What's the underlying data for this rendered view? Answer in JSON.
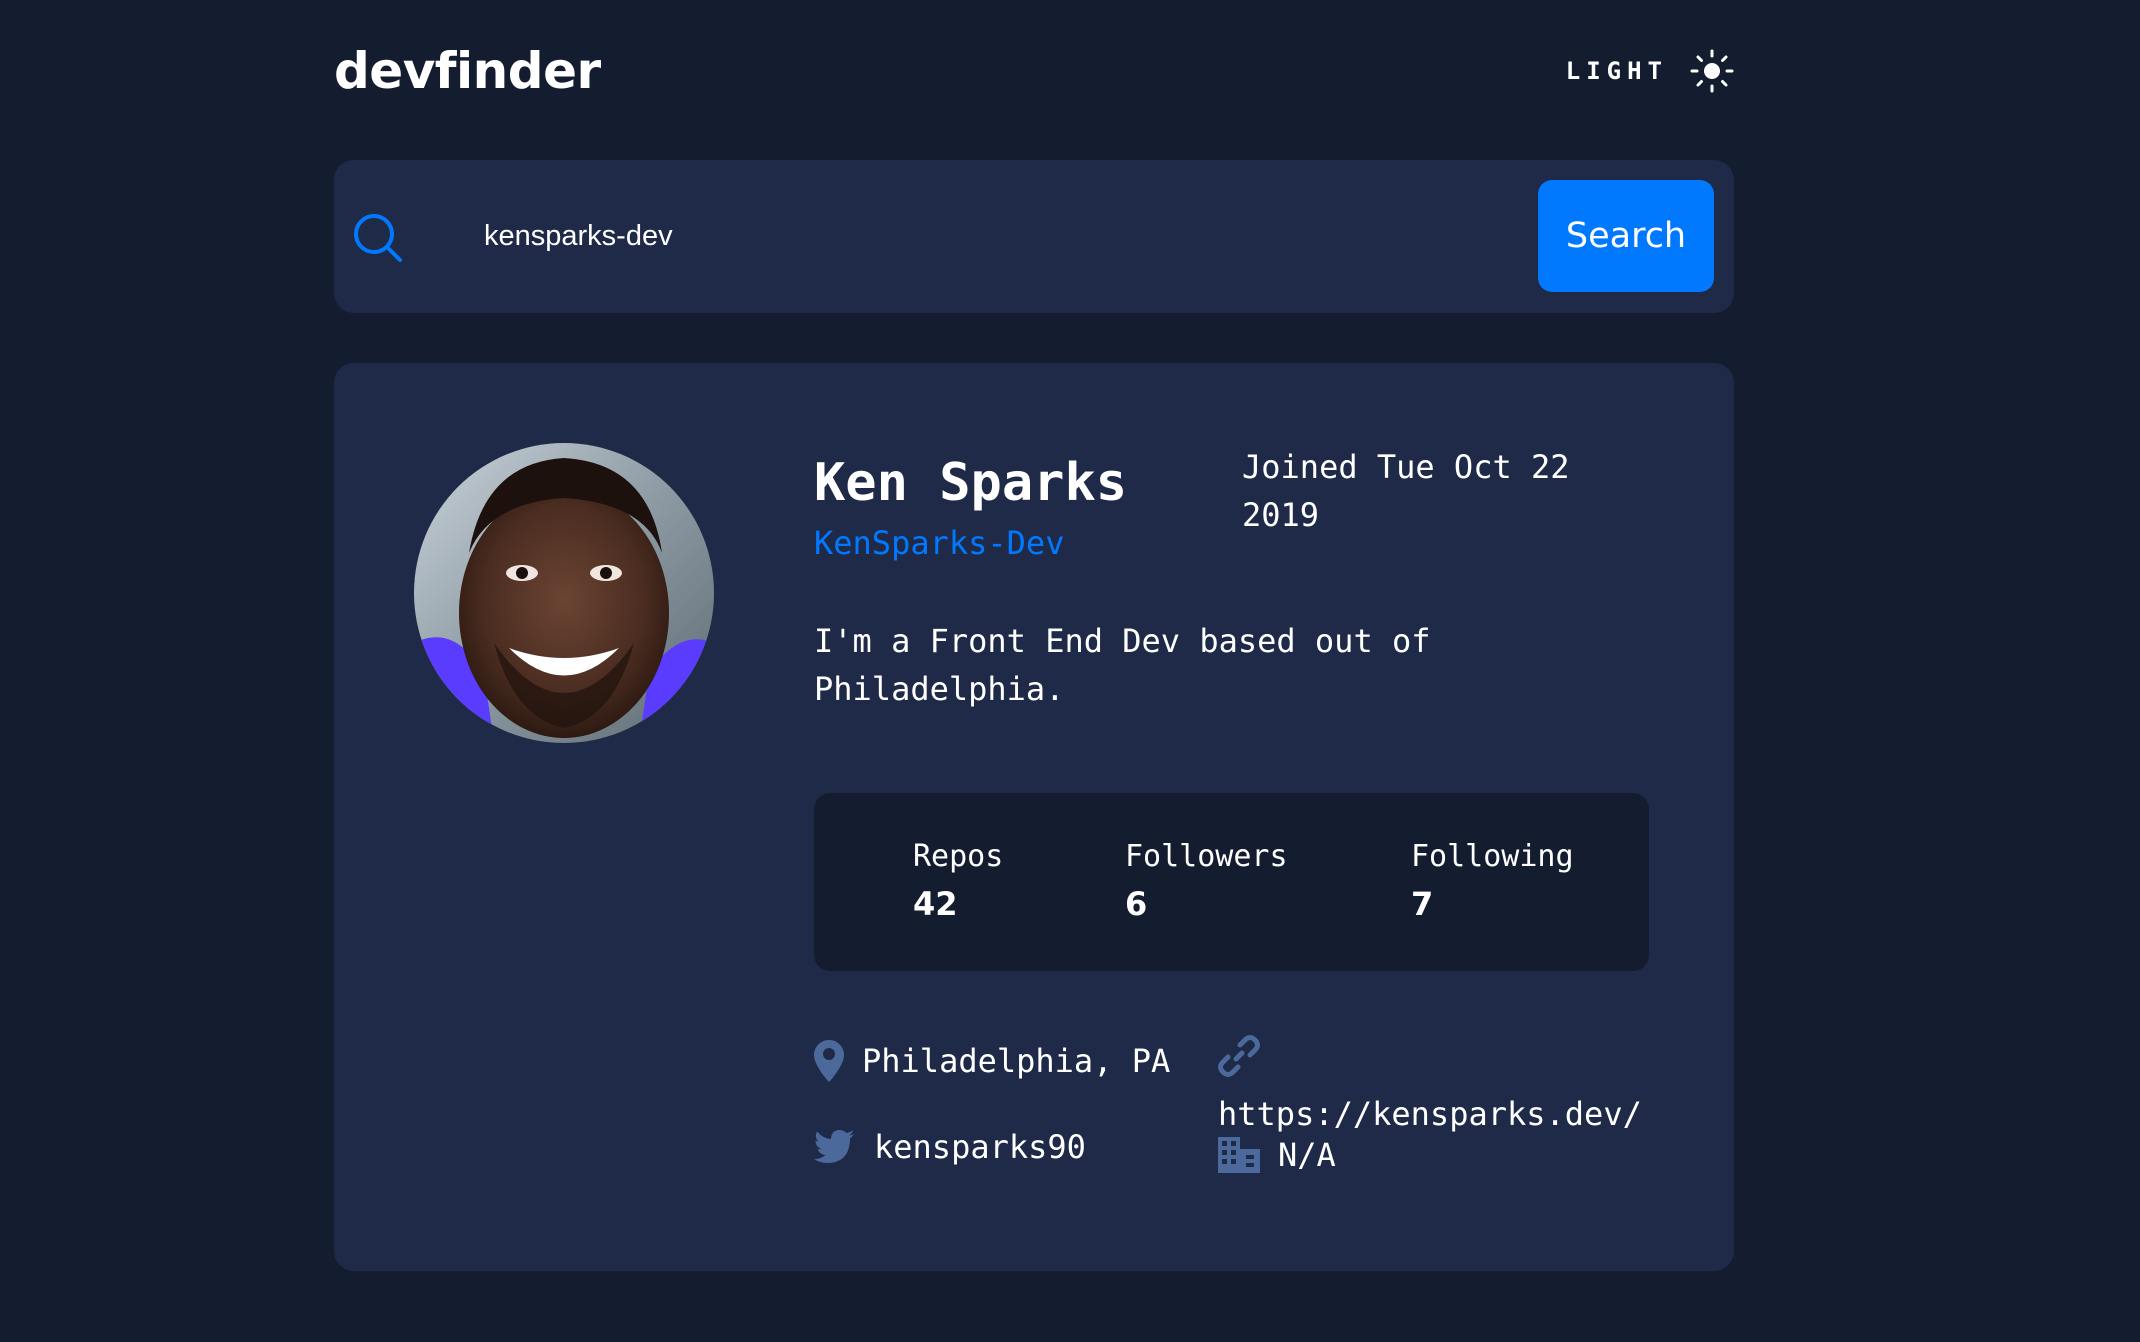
{
  "app": {
    "logo": "devfinder",
    "theme_toggle_label": "LIGHT"
  },
  "search": {
    "value": "kensparks-dev",
    "button_label": "Search"
  },
  "profile": {
    "name": "Ken Sparks",
    "handle": "KenSparks-Dev",
    "joined": "Joined Tue Oct 22 2019",
    "bio": "I'm a Front End Dev based out of Philadelphia.",
    "stats": [
      {
        "label": "Repos",
        "value": "42"
      },
      {
        "label": "Followers",
        "value": "6"
      },
      {
        "label": "Following",
        "value": "7"
      }
    ],
    "location": "Philadelphia, PA",
    "blog": "https://kensparks.dev/",
    "twitter": "kensparks90",
    "company": "N/A"
  },
  "colors": {
    "page_bg": "#141d2f",
    "card_bg": "#1e2a47",
    "accent": "#0079ff",
    "icon": "#4b6a9b",
    "text": "#ffffff"
  },
  "icons": {
    "theme": "sun-icon",
    "search": "search-icon",
    "location": "location-pin-icon",
    "blog": "link-icon",
    "twitter": "twitter-icon",
    "company": "building-icon"
  }
}
